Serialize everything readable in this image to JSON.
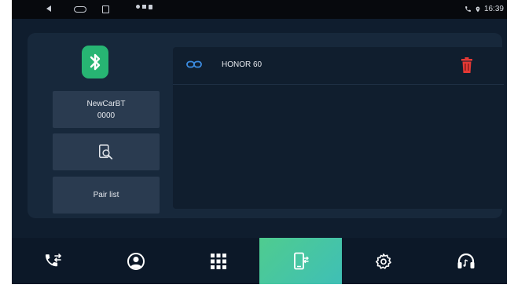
{
  "status_bar": {
    "time": "16:39",
    "icons": [
      "back-icon",
      "home-icon",
      "recents-icon",
      "notification-icons",
      "phone-icon",
      "location-icon"
    ]
  },
  "bluetooth": {
    "device_name": "NewCarBT",
    "pin": "0000",
    "search_icon": "search-device-icon",
    "pair_list_label": "Pair list"
  },
  "paired_devices": [
    {
      "name": "HONOR 60",
      "icon": "link-icon",
      "action_icon": "trash-icon"
    }
  ],
  "bottom_tabs": [
    {
      "name": "dialpad",
      "icon": "phone-transfer-icon",
      "active": false
    },
    {
      "name": "contacts",
      "icon": "contact-icon",
      "active": false
    },
    {
      "name": "keypad",
      "icon": "grid-icon",
      "active": false
    },
    {
      "name": "device",
      "icon": "phone-device-icon",
      "active": true
    },
    {
      "name": "settings",
      "icon": "gear-icon",
      "active": false
    },
    {
      "name": "music",
      "icon": "headphones-icon",
      "active": false
    }
  ],
  "colors": {
    "accent_green": "#27b573",
    "active_tab": "#4fcc8f",
    "trash_red": "#e53935",
    "link_blue": "#3b8be0",
    "background": "#0f1d2e"
  }
}
